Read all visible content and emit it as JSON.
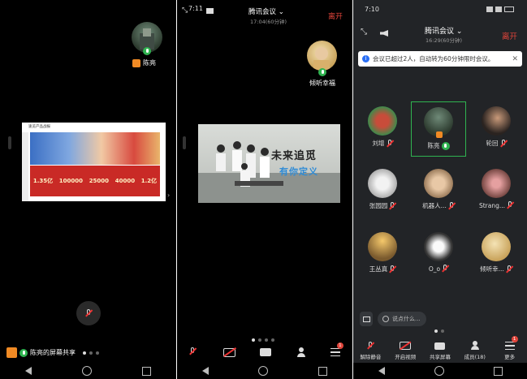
{
  "panel1": {
    "presenter_name": "陈亮",
    "share_label": "陈亮的屏幕共享",
    "slide_title": "速览产品战报",
    "slide_numbers": [
      "1.35亿",
      "100000",
      "25000",
      "40000",
      "1.2亿"
    ]
  },
  "panel2": {
    "time": "7:11",
    "app_title": "腾讯会议",
    "timer": "17:04(60分钟)",
    "leave": "离开",
    "speaker_name": "倾听幸福",
    "video_slogan_1": "未来追觅",
    "video_slogan_2": "有你定义",
    "badge_count": "1"
  },
  "panel3": {
    "time": "7:10",
    "app_title": "腾讯会议",
    "timer": "16:29(60分钟)",
    "leave": "离开",
    "notice": "会议已超过2人，自动转为60分钟限时会议。",
    "participants": [
      {
        "name": "刘增"
      },
      {
        "name": "陈亮"
      },
      {
        "name": "轮回"
      },
      {
        "name": "张园园"
      },
      {
        "name": "机器人..."
      },
      {
        "name": "Strang..."
      },
      {
        "name": "王丛真"
      },
      {
        "name": "O_o"
      },
      {
        "name": "倾听幸..."
      }
    ],
    "chat_placeholder": "说点什么...",
    "toolbar": {
      "unmute": "解除静音",
      "video": "开启视频",
      "share": "共享屏幕",
      "members": "成员(18)",
      "more": "更多",
      "more_badge": "1"
    }
  },
  "colors": {
    "accent_red": "#e0443a",
    "mic_green": "#2fb350",
    "blue": "#2a6ff5"
  }
}
